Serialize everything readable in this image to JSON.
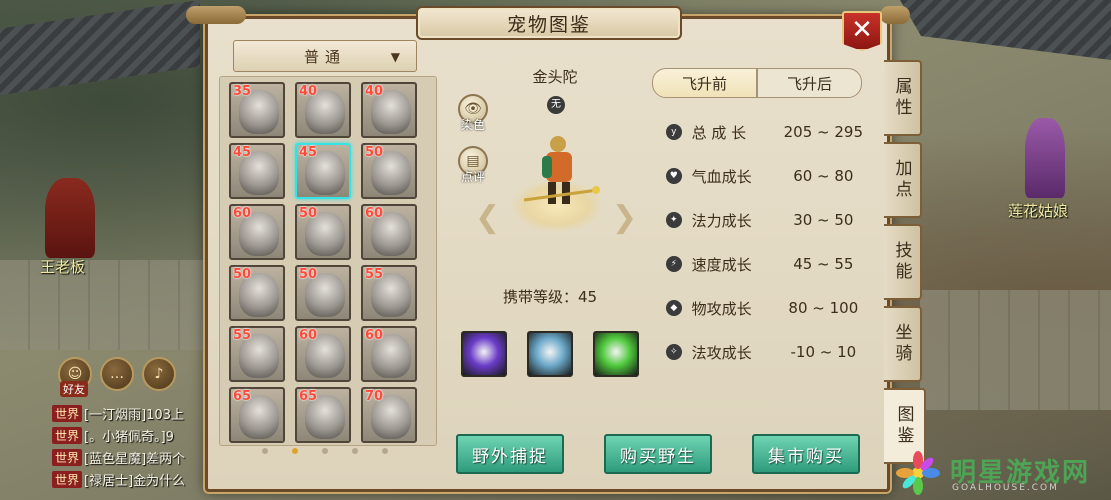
{
  "title": "宠物图鉴",
  "close_symbol": "✕",
  "filter": {
    "selected": "普通",
    "arrow": "▼"
  },
  "pet_grid": [
    {
      "level": "35",
      "selected": false
    },
    {
      "level": "40",
      "selected": false
    },
    {
      "level": "40",
      "selected": false
    },
    {
      "level": "45",
      "selected": false
    },
    {
      "level": "45",
      "selected": true
    },
    {
      "level": "50",
      "selected": false
    },
    {
      "level": "60",
      "selected": false
    },
    {
      "level": "50",
      "selected": false
    },
    {
      "level": "60",
      "selected": false
    },
    {
      "level": "50",
      "selected": false
    },
    {
      "level": "50",
      "selected": false
    },
    {
      "level": "55",
      "selected": false
    },
    {
      "level": "55",
      "selected": false
    },
    {
      "level": "60",
      "selected": false
    },
    {
      "level": "60",
      "selected": false
    },
    {
      "level": "65",
      "selected": false
    },
    {
      "level": "65",
      "selected": false
    },
    {
      "level": "70",
      "selected": false
    }
  ],
  "page_dots": {
    "count": 5,
    "active": 1
  },
  "pet": {
    "name": "金头陀",
    "element": "无",
    "dye_label": "染色",
    "review_label": "点评",
    "carry_level_label": "携带等级：45"
  },
  "tabs": [
    {
      "label": "飞升前",
      "active": true
    },
    {
      "label": "飞升后",
      "active": false
    }
  ],
  "stats": [
    {
      "icon": "y",
      "name": "总 成 长",
      "range": "205 ~ 295"
    },
    {
      "icon": "♥",
      "name": "气血成长",
      "range": "60 ~ 80"
    },
    {
      "icon": "✦",
      "name": "法力成长",
      "range": "30 ~ 50"
    },
    {
      "icon": "⚡",
      "name": "速度成长",
      "range": "45 ~ 55"
    },
    {
      "icon": "◆",
      "name": "物攻成长",
      "range": "80 ~ 100"
    },
    {
      "icon": "✧",
      "name": "法攻成长",
      "range": "-10 ~ 10"
    }
  ],
  "side_tabs": [
    {
      "label": "属性",
      "active": false
    },
    {
      "label": "加点",
      "active": false
    },
    {
      "label": "技能",
      "active": false
    },
    {
      "label": "坐骑",
      "active": false
    },
    {
      "label": "图鉴",
      "active": true
    }
  ],
  "actions": [
    {
      "label": "野外捕捉"
    },
    {
      "label": "购买野生"
    },
    {
      "label": "集市购买"
    }
  ],
  "skills": [
    {
      "color": "#6a3cc8"
    },
    {
      "color": "#6aa8c8"
    },
    {
      "color": "#4ec83c"
    }
  ],
  "world": {
    "npc_left": "王老板",
    "npc_right": "莲花姑娘",
    "friend_label": "好友",
    "chat_icon_msg": "…",
    "chat_icon_voice": "♪",
    "chat_icon_world": "世",
    "chat": [
      {
        "channel": "世界",
        "text": "[一汀烟雨]103上"
      },
      {
        "channel": "世界",
        "text": "[。小猪佩奇。]9"
      },
      {
        "channel": "世界",
        "text": "[蓝色星魔]差两个"
      },
      {
        "channel": "世界",
        "text": "[禄居士]金为什么"
      }
    ]
  },
  "watermark": {
    "text": "明星游戏网",
    "sub": "GOALHOUSE.COM"
  }
}
